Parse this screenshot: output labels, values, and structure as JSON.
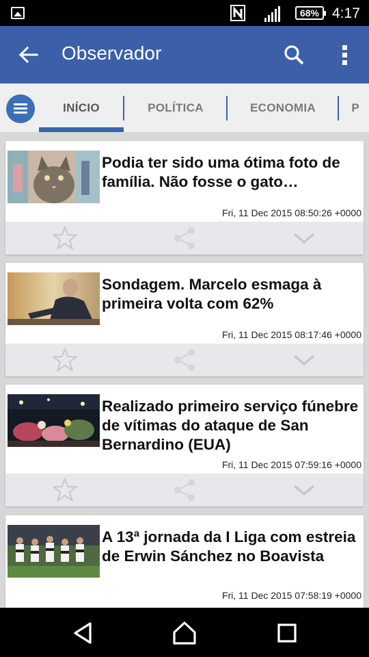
{
  "status_bar": {
    "battery": "68%",
    "time": "4:17",
    "icons": [
      "gallery-icon",
      "nfc-icon",
      "signal-icon",
      "battery-icon"
    ]
  },
  "app_bar": {
    "title": "Observador",
    "icons": [
      "back-arrow-icon",
      "search-icon",
      "more-vertical-icon"
    ]
  },
  "tabs": [
    {
      "label": "INÍCIO",
      "active": true
    },
    {
      "label": "POLÍTICA",
      "active": false
    },
    {
      "label": "ECONOMIA",
      "active": false
    },
    {
      "label": "P",
      "active": false
    }
  ],
  "articles": [
    {
      "title": "Podia ter sido uma ótima foto de família. Não fosse o gato…",
      "date": "Fri, 11 Dec 2015 08:50:26 +0000",
      "thumb": "cat-photo"
    },
    {
      "title": "Sondagem. Marcelo esmaga à primeira volta com 62%",
      "date": "Fri, 11 Dec 2015 08:17:46 +0000",
      "thumb": "man-portrait-photo"
    },
    {
      "title": "Realizado primeiro serviço fúnebre de vítimas do ataque de San Bernardino (EUA)",
      "date": "Fri, 11 Dec 2015 07:59:16 +0000",
      "thumb": "memorial-photo"
    },
    {
      "title": "A 13ª jornada da I Liga com estreia de Erwin Sánchez no Boavista",
      "date": "Fri, 11 Dec 2015 07:58:19 +0000",
      "thumb": "football-photo"
    }
  ],
  "card_actions": [
    "star-icon",
    "share-icon",
    "chevron-down-icon"
  ],
  "nav_bar": [
    "back-triangle-icon",
    "home-icon",
    "recents-icon"
  ],
  "colors": {
    "app_bar": "#3b5fa8",
    "tab_indicator": "#3b63a8",
    "menu_fab": "#3b6fb6",
    "feed_bg": "#d7d7d7",
    "actions_bg": "#e7e8ec"
  }
}
